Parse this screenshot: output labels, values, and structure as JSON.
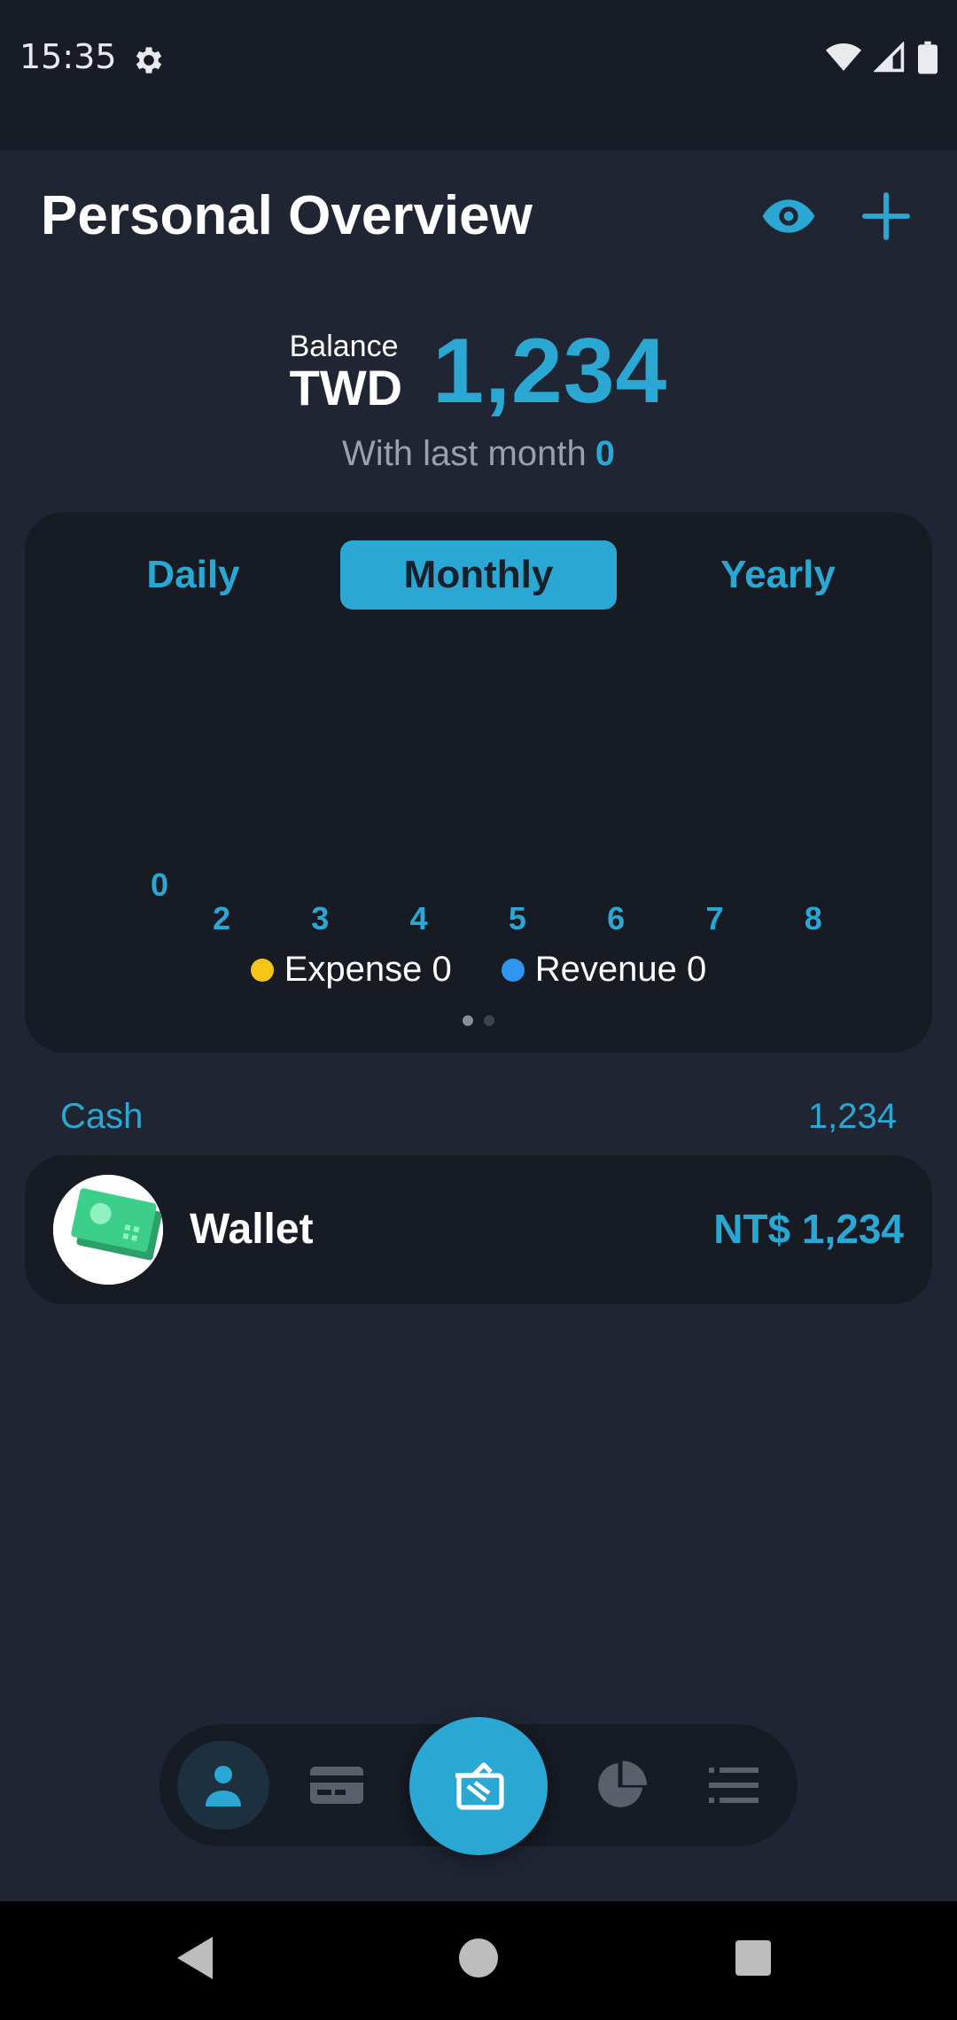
{
  "status_bar": {
    "time": "15:35"
  },
  "header": {
    "title": "Personal Overview"
  },
  "balance": {
    "label": "Balance",
    "currency": "TWD",
    "amount": "1,234",
    "last_month_label": "With last month",
    "last_month_value": "0"
  },
  "period_tabs": {
    "daily": "Daily",
    "monthly": "Monthly",
    "yearly": "Yearly",
    "selected": "Monthly"
  },
  "chart_data": {
    "type": "bar",
    "categories": [
      "2",
      "3",
      "4",
      "5",
      "6",
      "7",
      "8"
    ],
    "y_tick_zero": "0",
    "series": [
      {
        "name": "Expense",
        "values": [
          0,
          0,
          0,
          0,
          0,
          0,
          0
        ],
        "color": "#f5c518"
      },
      {
        "name": "Revenue",
        "values": [
          0,
          0,
          0,
          0,
          0,
          0,
          0
        ],
        "color": "#2f95f0"
      }
    ],
    "legend": [
      {
        "label": "Expense 0"
      },
      {
        "label": "Revenue 0"
      }
    ]
  },
  "accounts_section": {
    "label": "Cash",
    "total": "1,234"
  },
  "accounts": [
    {
      "name": "Wallet",
      "amount": "NT$ 1,234",
      "icon": "cash-icon"
    }
  ],
  "bottom_nav": {
    "items": [
      "profile-icon",
      "card-icon",
      "add-transaction-icon",
      "pie-chart-icon",
      "menu-icon"
    ],
    "active": "profile-icon"
  },
  "colors": {
    "accent": "#2aa8d3",
    "background": "#1f2533",
    "card": "#161b24",
    "expense": "#f5c518",
    "revenue": "#2f95f0"
  }
}
